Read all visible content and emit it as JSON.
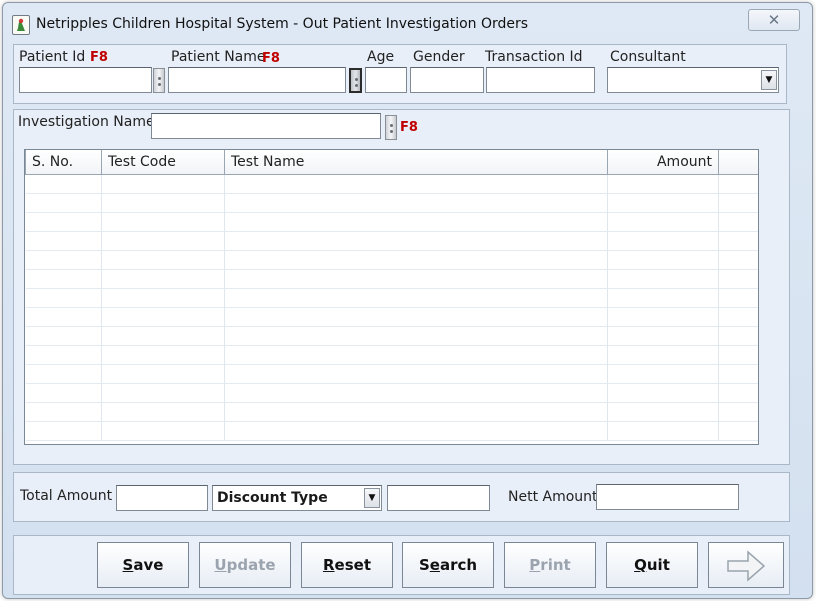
{
  "window": {
    "title": "Netripples Children Hospital  System - Out Patient Investigation Orders",
    "close_glyph": "✕"
  },
  "patient": {
    "patient_id_label": "Patient Id",
    "patient_id_hotkey": "F8",
    "patient_id_value": "",
    "patient_name_label": "Patient Name",
    "patient_name_hotkey": "F8",
    "patient_name_value": "",
    "age_label": "Age",
    "age_value": "",
    "gender_label": "Gender",
    "gender_value": "",
    "transaction_id_label": "Transaction Id",
    "transaction_id_value": "",
    "consultant_label": "Consultant",
    "consultant_value": ""
  },
  "investigation": {
    "label": "Investigation Name",
    "value": "",
    "hotkey": "F8"
  },
  "grid": {
    "columns": [
      "S. No.",
      "Test Code",
      "Test Name",
      "Amount"
    ],
    "rows": []
  },
  "totals": {
    "total_amount_label": "Total Amount",
    "total_amount_value": "",
    "discount_type_value": "Discount Type",
    "discount_value": "",
    "nett_amount_label": "Nett Amount",
    "nett_amount_value": ""
  },
  "buttons": {
    "save_first": "S",
    "save_rest": "ave",
    "update_first": "U",
    "update_rest": "pdate",
    "reset_first": "R",
    "reset_rest": "eset",
    "search_pre": "S",
    "search_mid": "e",
    "search_post": "arch",
    "print_first": "P",
    "print_rest": "rint",
    "quit_first": "Q",
    "quit_rest": "uit"
  },
  "icons": {
    "app": "app-logo-icon",
    "close": "close-icon",
    "next": "arrow-right-icon",
    "dropdown": "chevron-down-icon"
  }
}
